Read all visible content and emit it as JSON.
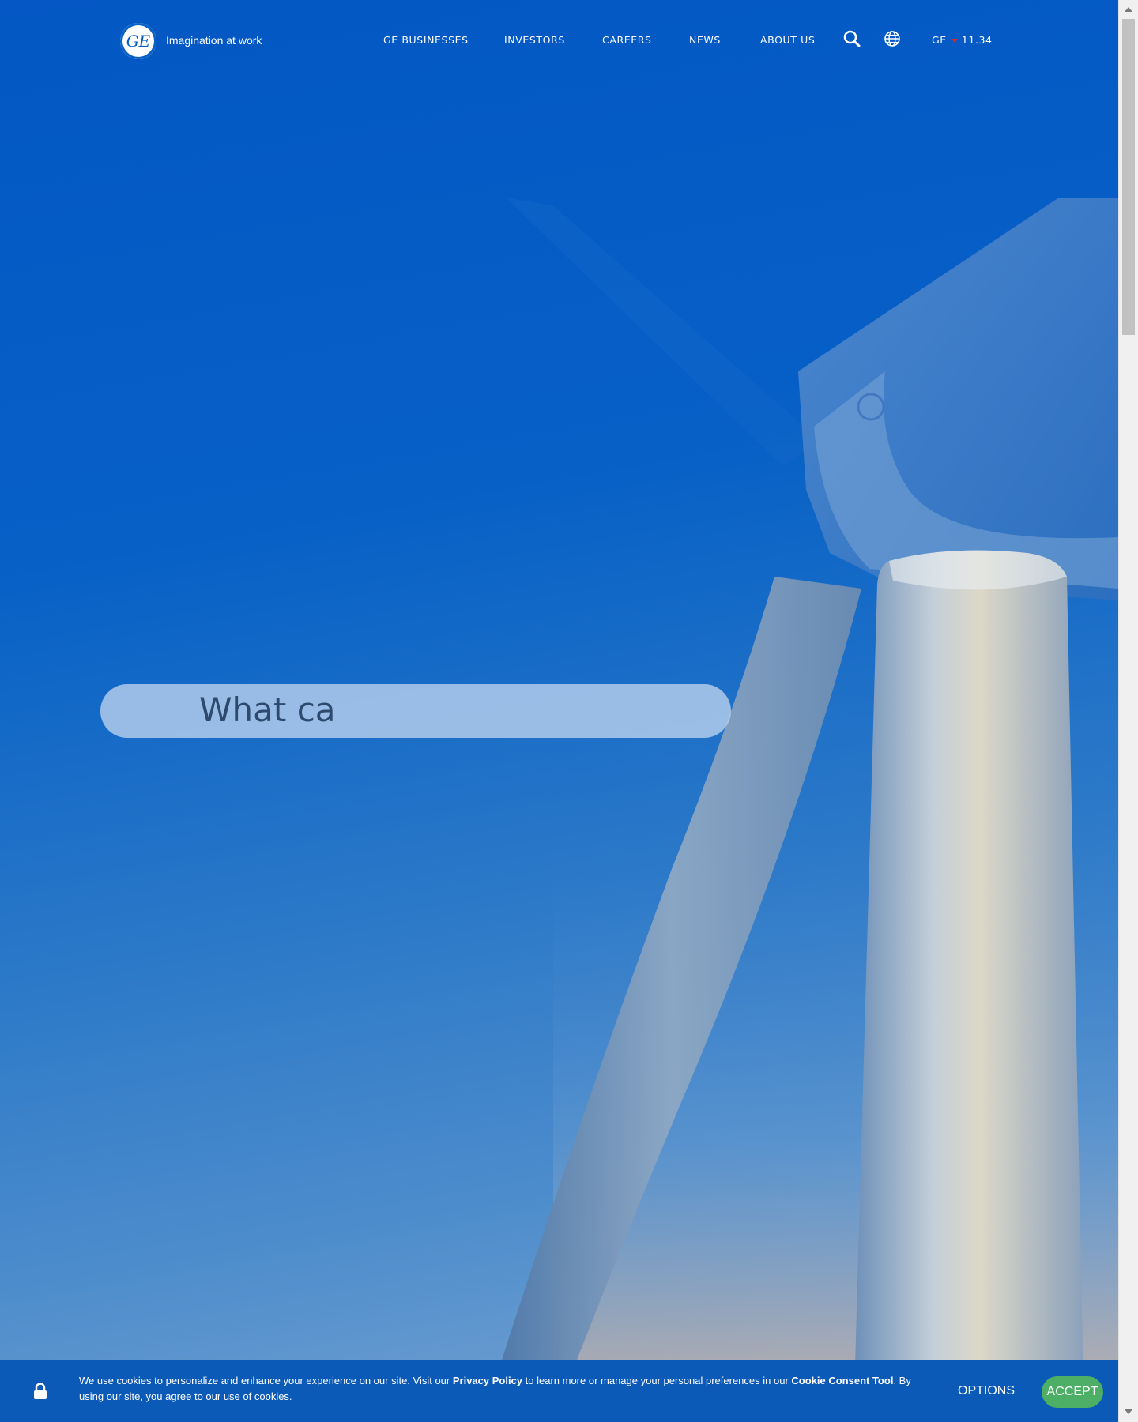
{
  "header": {
    "logo_icon": "ge-monogram-icon",
    "tagline": "Imagination at work",
    "nav": [
      {
        "label": "GE BUSINESSES"
      },
      {
        "label": "INVESTORS"
      },
      {
        "label": "CAREERS"
      },
      {
        "label": "NEWS"
      },
      {
        "label": "ABOUT US"
      }
    ],
    "search_icon": "search-icon",
    "globe_icon": "globe-icon",
    "ticker": {
      "symbol": "GE",
      "direction": "down",
      "value": "11.34",
      "arrow_color": "#d32b2b"
    }
  },
  "hero": {
    "search_text": "What ca",
    "image_subject": "wind-turbine"
  },
  "cookie_banner": {
    "text_before_privacy": "We use cookies to personalize and enhance your experience on our site. Visit our ",
    "privacy_link": "Privacy Policy",
    "text_middle": " to learn more or manage your personal preferences in our ",
    "consent_link": "Cookie Consent Tool",
    "text_after": ". By using our site, you agree to our use of cookies.",
    "options_label": "OPTIONS",
    "accept_label": "ACCEPT",
    "lock_icon": "lock-icon"
  },
  "colors": {
    "brand_blue": "#0660c6",
    "banner_blue": "#0b5ab8",
    "accept_green": "#4caf65"
  }
}
